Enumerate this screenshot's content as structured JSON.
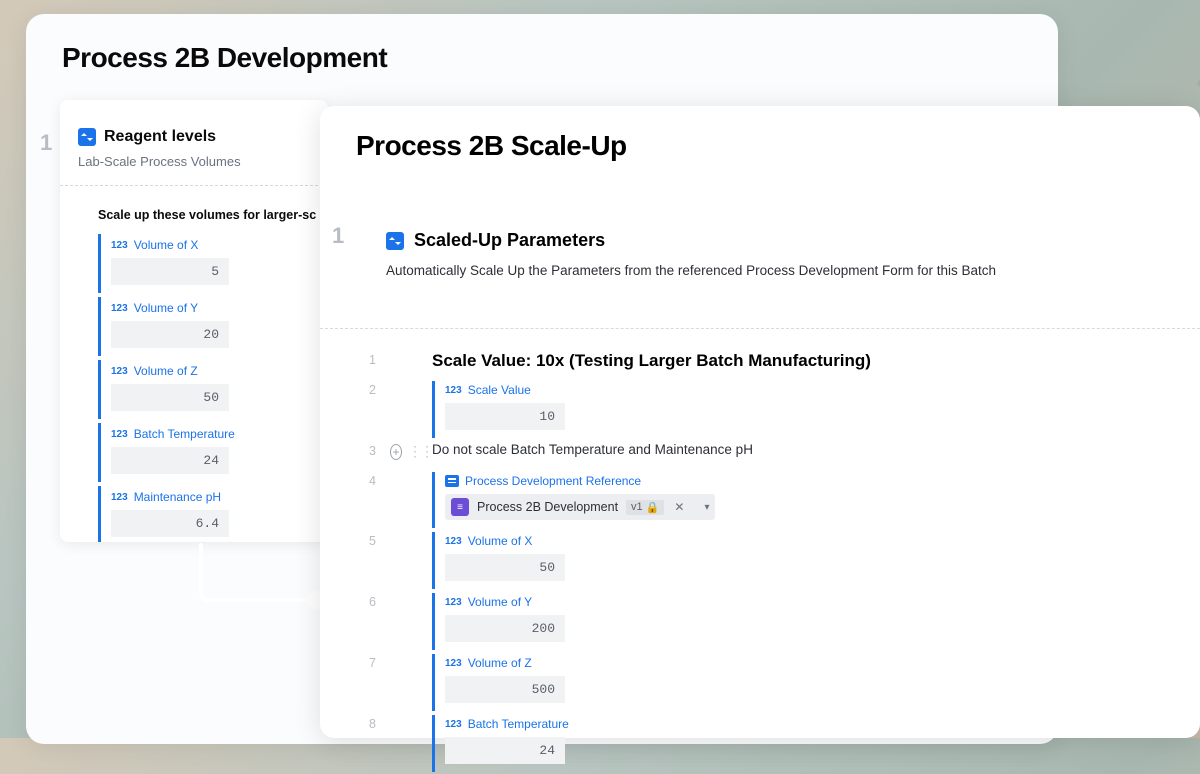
{
  "main": {
    "title": "Process 2B Development"
  },
  "left": {
    "title": "Reagent levels",
    "subtitle": "Lab-Scale Process Volumes",
    "scale_heading": "Scale up these volumes for larger-sc",
    "fields": [
      {
        "type": "123",
        "label": "Volume of X",
        "value": "5"
      },
      {
        "type": "123",
        "label": "Volume of Y",
        "value": "20"
      },
      {
        "type": "123",
        "label": "Volume of Z",
        "value": "50"
      },
      {
        "type": "123",
        "label": "Batch Temperature",
        "value": "24"
      },
      {
        "type": "123",
        "label": "Maintenance pH",
        "value": "6.4"
      }
    ]
  },
  "right": {
    "title": "Process 2B Scale-Up",
    "section_title": "Scaled-Up Parameters",
    "section_desc": "Automatically Scale Up the Parameters from the referenced Process Development Form for this Batch",
    "rows": {
      "r1_title": "Scale Value: 10x (Testing Larger Batch Manufacturing)",
      "r2": {
        "type": "123",
        "label": "Scale Value",
        "value": "10"
      },
      "r3_text": "Do not scale Batch Temperature and Maintenance pH",
      "r4": {
        "label": "Process Development Reference",
        "ref_name": "Process 2B Development",
        "ref_ver": "v1"
      },
      "r5": {
        "type": "123",
        "label": "Volume of X",
        "value": "50"
      },
      "r6": {
        "type": "123",
        "label": "Volume of Y",
        "value": "200"
      },
      "r7": {
        "type": "123",
        "label": "Volume of Z",
        "value": "500"
      },
      "r8": {
        "type": "123",
        "label": "Batch Temperature",
        "value": "24"
      }
    }
  },
  "step_label": "1"
}
